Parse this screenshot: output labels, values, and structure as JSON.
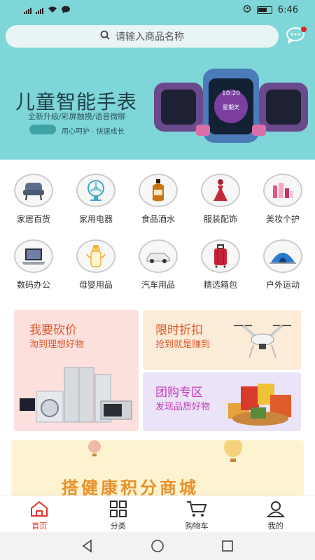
{
  "status_bar": {
    "left_icons": [
      "signal-4g-icon",
      "signal-4g-icon",
      "wifi-icon",
      "message-icon"
    ],
    "time": "6:46"
  },
  "search": {
    "placeholder": "请输入商品名称"
  },
  "banner": {
    "title": "儿童智能手表",
    "subtitle": "全新升级/彩屏触摸/语音微聊",
    "tagline": "用心呵护 · 快速成长",
    "watch_screen_time": "10:20",
    "watch_screen_day": "星期天"
  },
  "categories": [
    {
      "label": "家居百货",
      "icon": "armchair-icon"
    },
    {
      "label": "家用电器",
      "icon": "fan-icon"
    },
    {
      "label": "食品酒水",
      "icon": "liquor-bottle-icon"
    },
    {
      "label": "服装配饰",
      "icon": "dress-icon"
    },
    {
      "label": "美妆个护",
      "icon": "cosmetics-icon"
    },
    {
      "label": "数码办公",
      "icon": "laptop-icon"
    },
    {
      "label": "母婴用品",
      "icon": "baby-bottle-icon"
    },
    {
      "label": "汽车用品",
      "icon": "car-icon"
    },
    {
      "label": "精选箱包",
      "icon": "suitcase-icon"
    },
    {
      "label": "户外运动",
      "icon": "tent-icon"
    }
  ],
  "promos": {
    "bargain": {
      "title": "我要砍价",
      "subtitle": "淘到理想好物",
      "icon": "appliances-icon"
    },
    "flash": {
      "title": "限时折扣",
      "subtitle": "抢到就是赚到",
      "icon": "drone-icon"
    },
    "group": {
      "title": "团购专区",
      "subtitle": "发现品质好物",
      "icon": "snacks-icon"
    }
  },
  "mall_banner": {
    "title": "搭健康积分商城"
  },
  "tabs": [
    {
      "label": "首页",
      "icon": "home-icon",
      "active": true
    },
    {
      "label": "分类",
      "icon": "grid-icon",
      "active": false
    },
    {
      "label": "购物车",
      "icon": "cart-icon",
      "active": false
    },
    {
      "label": "我的",
      "icon": "user-icon",
      "active": false
    }
  ],
  "colors": {
    "accent": "#e4322b",
    "banner_bg": "#7fd6d8",
    "bargain_title": "#e05a2b",
    "group_title": "#c23fb7"
  }
}
